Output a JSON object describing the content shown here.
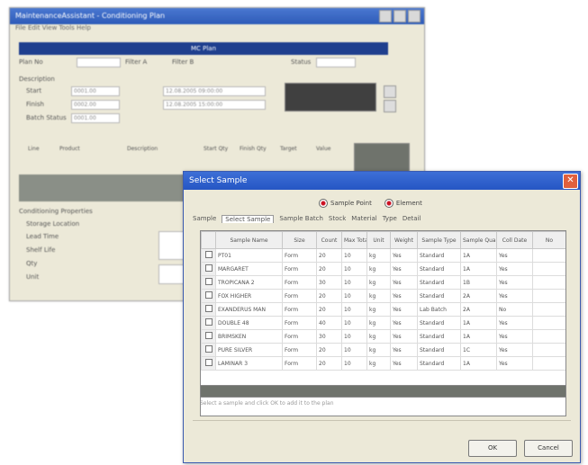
{
  "back_window": {
    "title": "MaintenanceAssistant - Conditioning Plan",
    "menu": "File  Edit  View  Tools  Help",
    "header_bar": "MC Plan",
    "filter_a_label": "Filter A",
    "filter_b_label": "Filter B",
    "status_label": "Status",
    "left_labels": [
      "Plan No",
      "Description",
      "Start",
      "Finish",
      "Batch Status"
    ],
    "col_labels": [
      "Line",
      "Product",
      "Description",
      "Start Qty",
      "Finish Qty",
      "Target",
      "Value"
    ],
    "lower_labels": [
      "Conditioning Properties",
      "Storage Location",
      "Lead Time",
      "Shelf Life",
      "Qty",
      "Unit"
    ],
    "field_values": [
      "0001.00",
      "0002.00",
      "12.08.2005 09:00:00",
      "12.08.2005 15:00:00",
      "0001.00"
    ]
  },
  "dialog": {
    "title": "Select Sample",
    "close_glyph": "✕",
    "radio_a": "Sample Point",
    "radio_b": "Element",
    "tabs": [
      "Sample",
      "Select Sample",
      "Sample Batch",
      "Stock",
      "Material",
      "Type",
      "Detail"
    ],
    "columns": [
      "",
      "Sample Name",
      "Size",
      "Count",
      "Max Total",
      "Unit",
      "Weight",
      "Sample Type",
      "Sample Quality",
      "Coll Date",
      "No"
    ],
    "rows": [
      [
        "PT01",
        "Form",
        "20",
        "10",
        "kg",
        "Yes",
        "Standard",
        "1A",
        "Yes"
      ],
      [
        "MARGARET",
        "Form",
        "20",
        "10",
        "kg",
        "Yes",
        "Standard",
        "1A",
        "Yes"
      ],
      [
        "TROPICANA 2",
        "Form",
        "30",
        "10",
        "kg",
        "Yes",
        "Standard",
        "1B",
        "Yes"
      ],
      [
        "FOX HIGHER",
        "Form",
        "20",
        "10",
        "kg",
        "Yes",
        "Standard",
        "2A",
        "Yes"
      ],
      [
        "EXANDERUS MAN",
        "Form",
        "20",
        "10",
        "kg",
        "Yes",
        "Lab Batch",
        "2A",
        "No"
      ],
      [
        "DOUBLE 48",
        "Form",
        "40",
        "10",
        "kg",
        "Yes",
        "Standard",
        "1A",
        "Yes"
      ],
      [
        "BRIMSKEN",
        "Form",
        "30",
        "10",
        "kg",
        "Yes",
        "Standard",
        "1A",
        "Yes"
      ],
      [
        "PURE SILVER",
        "Form",
        "20",
        "10",
        "kg",
        "Yes",
        "Standard",
        "1C",
        "Yes"
      ],
      [
        "LAMINAR 3",
        "Form",
        "20",
        "10",
        "kg",
        "Yes",
        "Standard",
        "1A",
        "Yes"
      ]
    ],
    "note": "Select a sample and click OK to add it to the plan",
    "ok_label": "OK",
    "cancel_label": "Cancel"
  }
}
